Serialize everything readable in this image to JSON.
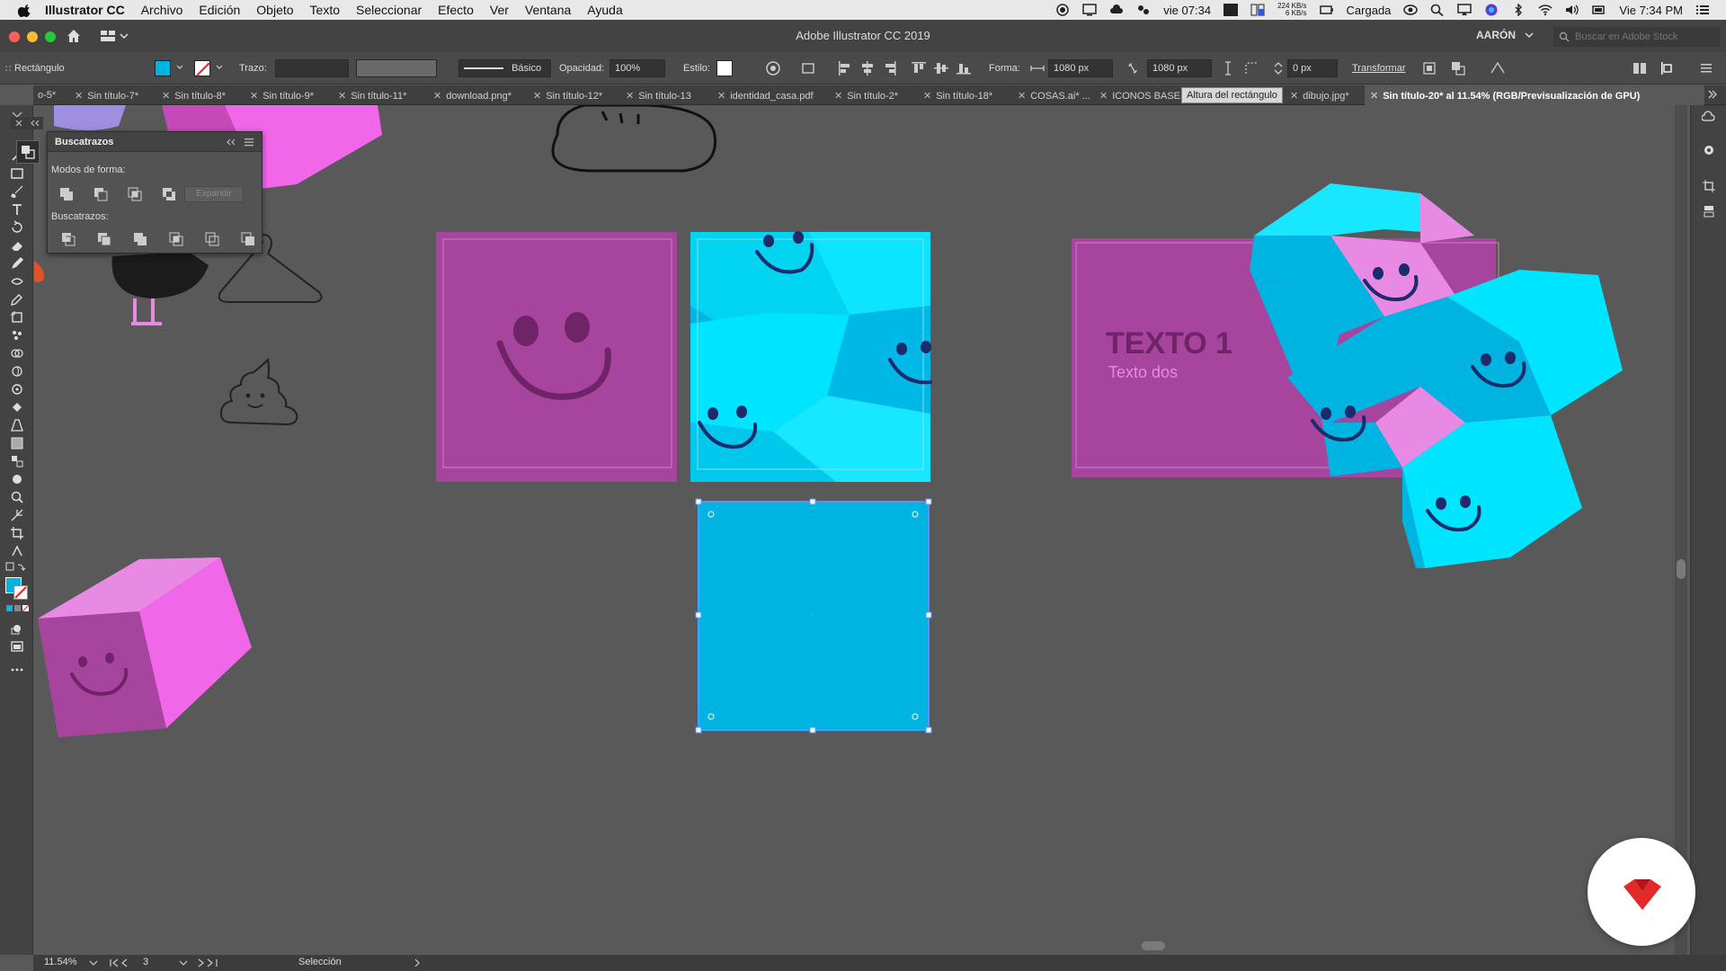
{
  "menubar": {
    "app_name": "Illustrator CC",
    "items": [
      "Archivo",
      "Edición",
      "Objeto",
      "Texto",
      "Seleccionar",
      "Efecto",
      "Ver",
      "Ventana",
      "Ayuda"
    ],
    "clock_short": "vie 07:34",
    "net_up": "224 KB/s",
    "net_down": "6 KB/s",
    "battery_status": "Cargada",
    "clock": "Vie 7:34 PM"
  },
  "titlebar": {
    "title": "Adobe Illustrator CC 2019",
    "user": "AARÓN",
    "search_placeholder": "Buscar en Adobe Stock"
  },
  "control_bar": {
    "object_type": "Rectángulo",
    "fill_color": "#00b4e2",
    "stroke_label": "Trazo:",
    "brush_label": "Básico",
    "opacity_label": "Opacidad:",
    "opacity_value": "100%",
    "style_label": "Estilo:",
    "shape_label": "Forma:",
    "width_value": "1080 px",
    "height_value": "1080 px",
    "corner_value": "0 px",
    "transform_label": "Transformar"
  },
  "tabs": {
    "items": [
      "o-5*",
      "Sin título-7*",
      "Sin título-8*",
      "Sin título-9*",
      "Sin título-11*",
      "download.png*",
      "Sin título-12*",
      "Sin título-13",
      "identidad_casa.pdf",
      "Sin título-2*",
      "Sin título-18*",
      "COSAS.ai* ...",
      "ICONOS BASE",
      "dibujo.jpg*"
    ],
    "active": "Sin título-20* al 11.54% (RGB/Previsualización de GPU)",
    "tooltip": "Altura del rectángulo"
  },
  "pathfinder": {
    "title": "Buscatrazos",
    "shape_modes_label": "Modos de forma:",
    "expand_label": "Expandir",
    "pathfinders_label": "Buscatrazos:"
  },
  "artwork": {
    "title_text": "TEXTO 1",
    "subtitle_text": "Texto dos",
    "magenta": "#a6449e",
    "cyan": "#00e5ff",
    "cyan_dark": "#00b4e2",
    "pink": "#e88ae3",
    "navy": "#1b2b6b"
  },
  "status_bar": {
    "zoom": "11.54%",
    "artboard": "3",
    "tool": "Selección"
  },
  "icons": [
    "apple-icon",
    "home-icon",
    "search-icon",
    "wifi-icon",
    "bluetooth-icon",
    "battery-icon",
    "volume-icon",
    "menu-icon",
    "logo-icon"
  ]
}
